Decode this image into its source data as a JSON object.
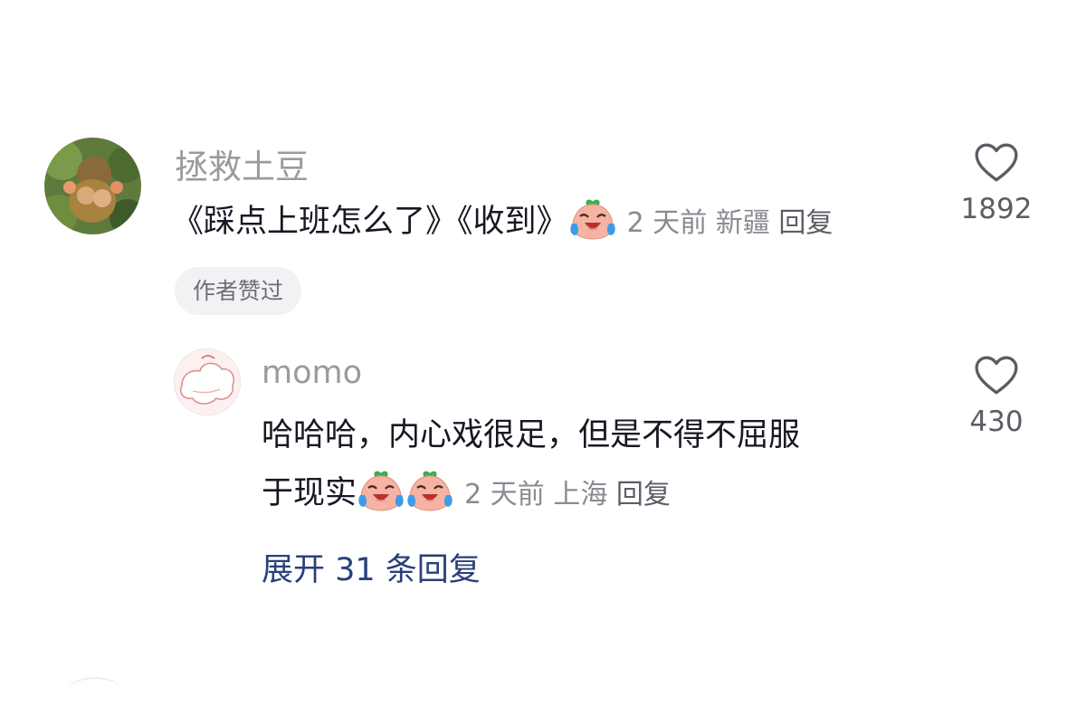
{
  "comment": {
    "author": "拯救土豆",
    "text": "《踩点上班怎么了》《收到》",
    "emoji": "crying-laughing-peach-emoji",
    "time": "2 天前",
    "location": "新疆",
    "reply_label": "回复",
    "likes": "1892",
    "badge": "作者赞过"
  },
  "reply": {
    "author": "momo",
    "text_line1": "哈哈哈，内心戏很足，但是不得不屈服",
    "text_line2": "于现实",
    "emoji": "crying-laughing-peach-emoji",
    "time": "2 天前",
    "location": "上海",
    "reply_label": "回复",
    "likes": "430"
  },
  "expand_label": "展开 31 条回复",
  "icons": {
    "like": "heart-outline-icon"
  },
  "colors": {
    "text": "#161823",
    "name": "#9a9a9f",
    "meta": "#8a8b91",
    "link": "#29407a",
    "badge_bg": "#f2f2f4"
  }
}
